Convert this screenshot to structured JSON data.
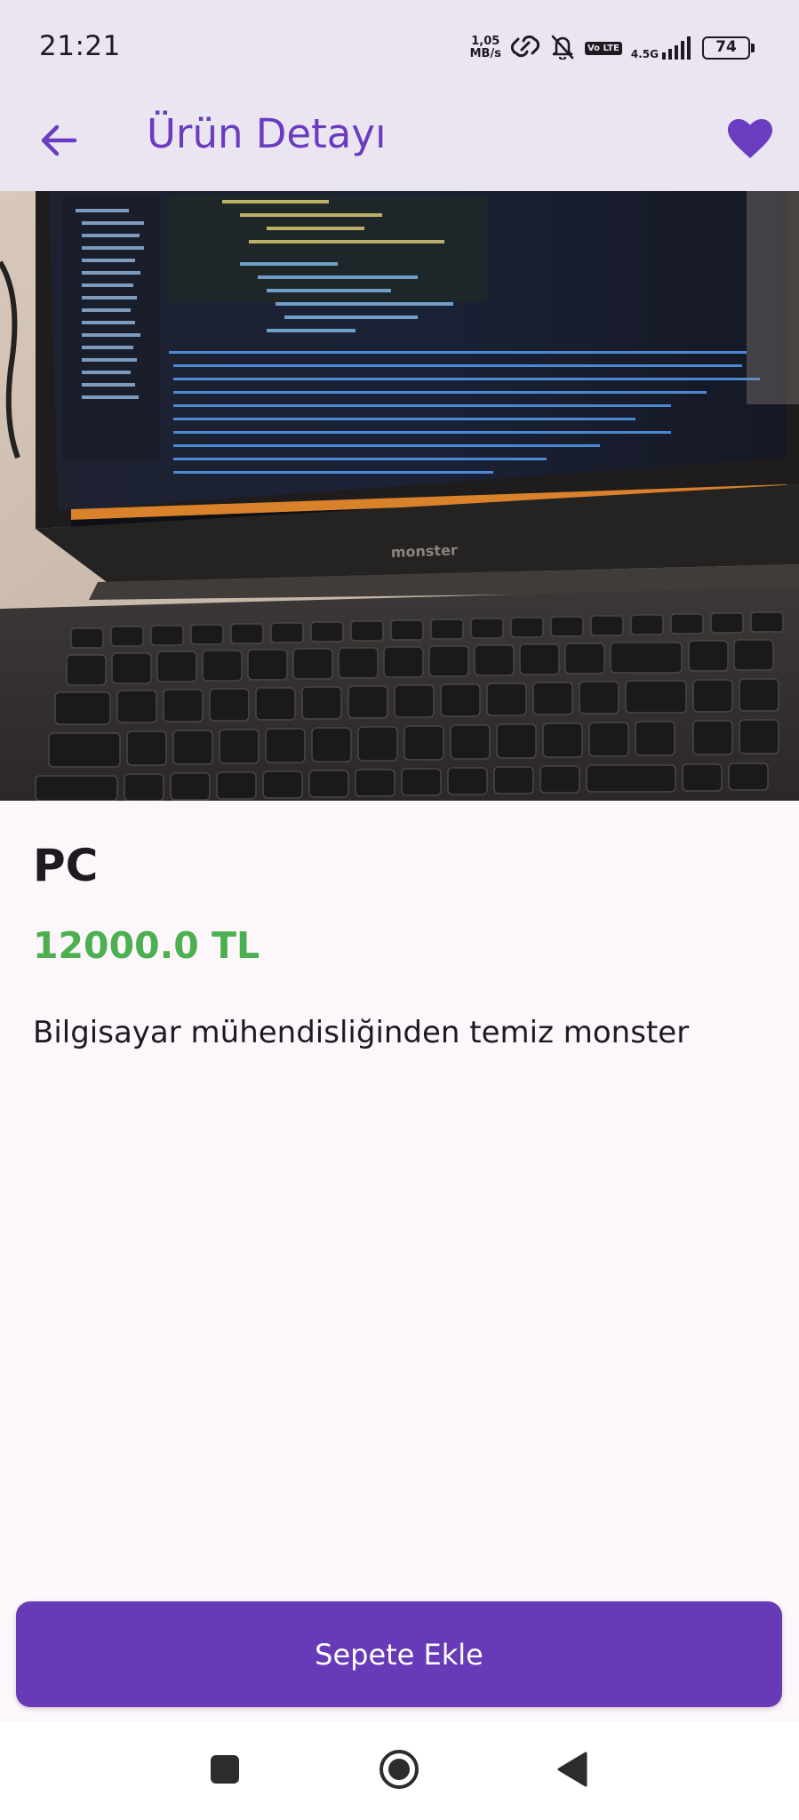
{
  "status_bar": {
    "time": "21:21",
    "net_speed_value": "1,05",
    "net_speed_unit": "MB/s",
    "lte_label": "Vo LTE",
    "network_gen": "4.5G",
    "battery_level": "74",
    "icons": [
      "link-icon",
      "bell-off-icon",
      "volte-icon",
      "signal-icon",
      "battery-icon"
    ]
  },
  "app_bar": {
    "title": "Ürün Detayı",
    "back_icon": "arrow-back-icon",
    "favorite_icon": "heart-icon"
  },
  "product": {
    "image_alt_icon": "product-photo",
    "name": "PC",
    "price": "12000.0 TL",
    "description": "Bilgisayar mühendisliğinden temiz monster",
    "brand_text": "monster"
  },
  "actions": {
    "add_to_cart": "Sepete Ekle"
  },
  "colors": {
    "accent": "#673ab7",
    "title": "#6a3cbf",
    "price": "#4caf50",
    "bar_bg": "#ebe5f2",
    "page_bg": "#fdf7fc"
  },
  "nav_bar": {
    "icons": [
      "recents-square-icon",
      "home-circle-icon",
      "back-triangle-icon"
    ]
  }
}
